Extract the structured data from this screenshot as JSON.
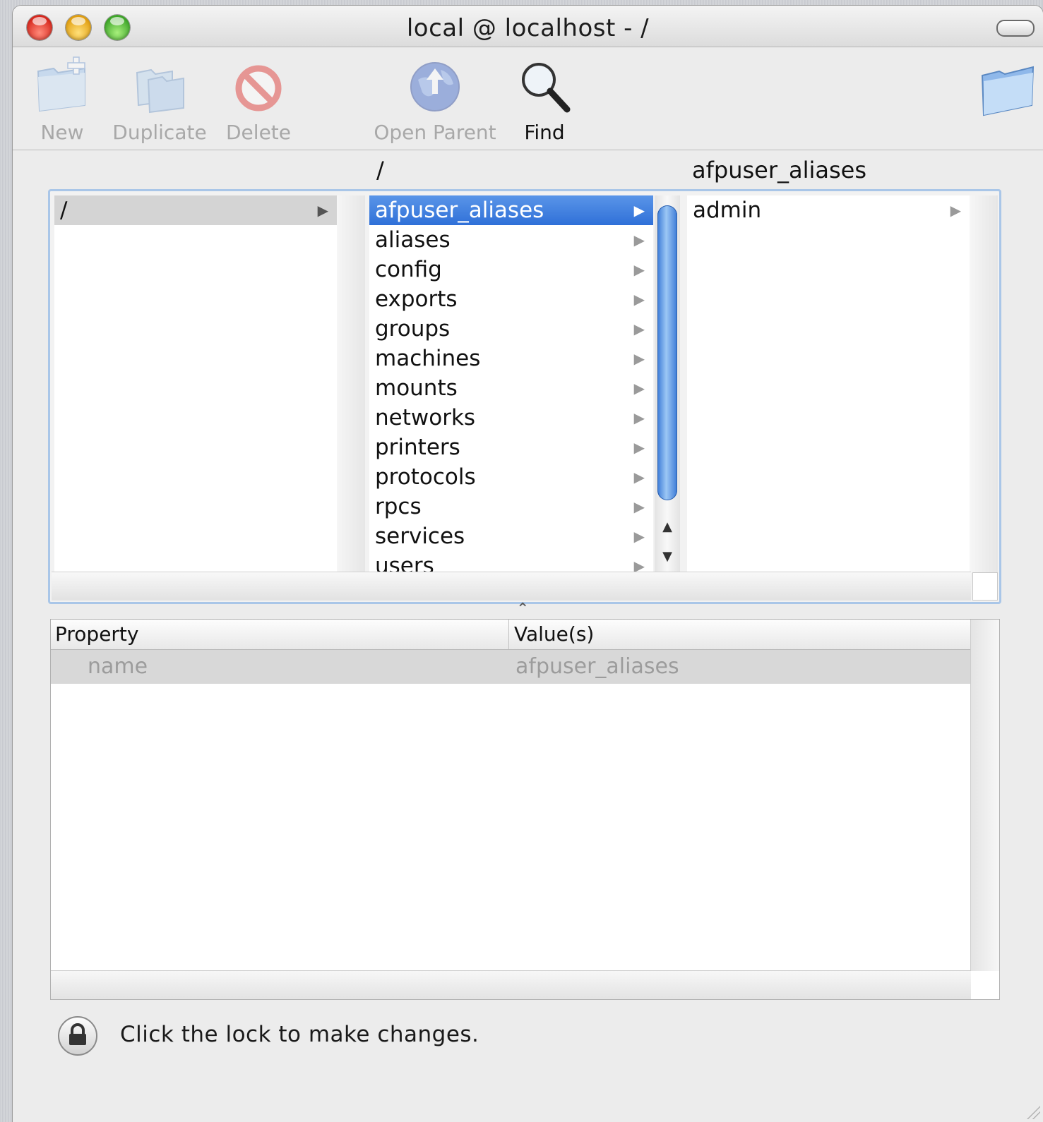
{
  "window": {
    "title": "local @ localhost - /"
  },
  "toolbar": {
    "buttons": [
      {
        "label": "New",
        "icon": "new-folder-icon",
        "enabled": false
      },
      {
        "label": "Duplicate",
        "icon": "duplicate-icon",
        "enabled": false
      },
      {
        "label": "Delete",
        "icon": "delete-icon",
        "enabled": false
      },
      {
        "label": "Open Parent",
        "icon": "open-parent-globe-icon",
        "enabled": false
      },
      {
        "label": "Find",
        "icon": "magnifier-icon",
        "enabled": true
      }
    ],
    "right_icon": "folder-icon"
  },
  "browser": {
    "column_headers": [
      "",
      "/",
      "afpuser_aliases"
    ],
    "column1": [
      {
        "label": "/",
        "selected": true
      }
    ],
    "column2": [
      {
        "label": "afpuser_aliases",
        "selected": true
      },
      {
        "label": "aliases"
      },
      {
        "label": "config"
      },
      {
        "label": "exports"
      },
      {
        "label": "groups"
      },
      {
        "label": "machines"
      },
      {
        "label": "mounts"
      },
      {
        "label": "networks"
      },
      {
        "label": "printers"
      },
      {
        "label": "protocols"
      },
      {
        "label": "rpcs"
      },
      {
        "label": "services"
      },
      {
        "label": "users"
      }
    ],
    "column3": [
      {
        "label": "admin"
      }
    ]
  },
  "properties": {
    "headers": {
      "property": "Property",
      "values": "Value(s)"
    },
    "rows": [
      {
        "property": "name",
        "value": "afpuser_aliases"
      }
    ]
  },
  "footer": {
    "lock_text": "Click the lock to make changes.",
    "lock_icon": "lock-icon"
  },
  "colors": {
    "selection_blue": "#3a7be0",
    "frame_blue": "#a9c6e8"
  }
}
